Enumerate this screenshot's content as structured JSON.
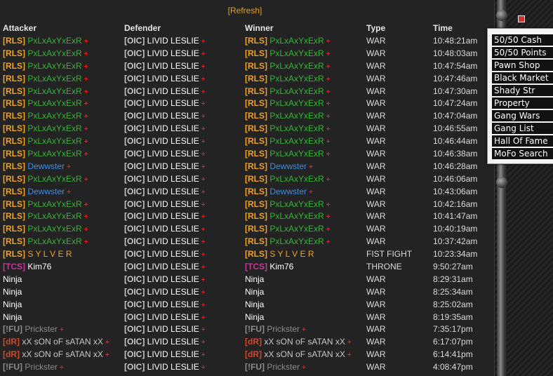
{
  "refresh": {
    "open": "[",
    "label": "Refresh",
    "close": "]"
  },
  "columns": [
    "Attacker",
    "Defender",
    "Winner",
    "Type",
    "Time"
  ],
  "colors": {
    "RLS": "#f0a020",
    "OIC": "#c8c8c8",
    "TCS": "#cc3399",
    "FU": "#8c8c8c",
    "dR": "#d04a2a",
    "plus": "#e02020"
  },
  "rows": [
    {
      "attacker": {
        "tag": "[RLS]",
        "tagColor": "#f0a020",
        "name": "PxLxAxYxExR",
        "nameColor": "#35b535",
        "plus": "+"
      },
      "defender": {
        "tag": "[OIC]",
        "tagColor": "#c8c8c8",
        "name": "LIVID LESLIE",
        "nameColor": "#ffffff",
        "plus": "+"
      },
      "winner": {
        "tag": "[RLS]",
        "tagColor": "#f0a020",
        "name": "PxLxAxYxExR",
        "nameColor": "#35b535",
        "plus": "+"
      },
      "type": "WAR",
      "time": "10:48:21am"
    },
    {
      "attacker": {
        "tag": "[RLS]",
        "tagColor": "#f0a020",
        "name": "PxLxAxYxExR",
        "nameColor": "#35b535",
        "plus": "+"
      },
      "defender": {
        "tag": "[OIC]",
        "tagColor": "#c8c8c8",
        "name": "LIVID LESLIE",
        "nameColor": "#ffffff",
        "plus": "+"
      },
      "winner": {
        "tag": "[RLS]",
        "tagColor": "#f0a020",
        "name": "PxLxAxYxExR",
        "nameColor": "#35b535",
        "plus": "+"
      },
      "type": "WAR",
      "time": "10:48:03am"
    },
    {
      "attacker": {
        "tag": "[RLS]",
        "tagColor": "#f0a020",
        "name": "PxLxAxYxExR",
        "nameColor": "#35b535",
        "plus": "+"
      },
      "defender": {
        "tag": "[OIC]",
        "tagColor": "#c8c8c8",
        "name": "LIVID LESLIE",
        "nameColor": "#ffffff",
        "plus": "+"
      },
      "winner": {
        "tag": "[RLS]",
        "tagColor": "#f0a020",
        "name": "PxLxAxYxExR",
        "nameColor": "#35b535",
        "plus": "+"
      },
      "type": "WAR",
      "time": "10:47:54am"
    },
    {
      "attacker": {
        "tag": "[RLS]",
        "tagColor": "#f0a020",
        "name": "PxLxAxYxExR",
        "nameColor": "#35b535",
        "plus": "+"
      },
      "defender": {
        "tag": "[OIC]",
        "tagColor": "#c8c8c8",
        "name": "LIVID LESLIE",
        "nameColor": "#ffffff",
        "plus": "+"
      },
      "winner": {
        "tag": "[RLS]",
        "tagColor": "#f0a020",
        "name": "PxLxAxYxExR",
        "nameColor": "#35b535",
        "plus": "+"
      },
      "type": "WAR",
      "time": "10:47:46am"
    },
    {
      "attacker": {
        "tag": "[RLS]",
        "tagColor": "#f0a020",
        "name": "PxLxAxYxExR",
        "nameColor": "#35b535",
        "plus": "+"
      },
      "defender": {
        "tag": "[OIC]",
        "tagColor": "#c8c8c8",
        "name": "LIVID LESLIE",
        "nameColor": "#ffffff",
        "plus": "+"
      },
      "winner": {
        "tag": "[RLS]",
        "tagColor": "#f0a020",
        "name": "PxLxAxYxExR",
        "nameColor": "#35b535",
        "plus": "+"
      },
      "type": "WAR",
      "time": "10:47:30am"
    },
    {
      "attacker": {
        "tag": "[RLS]",
        "tagColor": "#f0a020",
        "name": "PxLxAxYxExR",
        "nameColor": "#35b535",
        "plus": "+"
      },
      "defender": {
        "tag": "[OIC]",
        "tagColor": "#c8c8c8",
        "name": "LIVID LESLIE",
        "nameColor": "#ffffff",
        "plus": "+"
      },
      "winner": {
        "tag": "[RLS]",
        "tagColor": "#f0a020",
        "name": "PxLxAxYxExR",
        "nameColor": "#35b535",
        "plus": "+"
      },
      "type": "WAR",
      "time": "10:47:24am"
    },
    {
      "attacker": {
        "tag": "[RLS]",
        "tagColor": "#f0a020",
        "name": "PxLxAxYxExR",
        "nameColor": "#35b535",
        "plus": "+"
      },
      "defender": {
        "tag": "[OIC]",
        "tagColor": "#c8c8c8",
        "name": "LIVID LESLIE",
        "nameColor": "#ffffff",
        "plus": "+"
      },
      "winner": {
        "tag": "[RLS]",
        "tagColor": "#f0a020",
        "name": "PxLxAxYxExR",
        "nameColor": "#35b535",
        "plus": "+"
      },
      "type": "WAR",
      "time": "10:47:04am"
    },
    {
      "attacker": {
        "tag": "[RLS]",
        "tagColor": "#f0a020",
        "name": "PxLxAxYxExR",
        "nameColor": "#35b535",
        "plus": "+"
      },
      "defender": {
        "tag": "[OIC]",
        "tagColor": "#c8c8c8",
        "name": "LIVID LESLIE",
        "nameColor": "#ffffff",
        "plus": "+"
      },
      "winner": {
        "tag": "[RLS]",
        "tagColor": "#f0a020",
        "name": "PxLxAxYxExR",
        "nameColor": "#35b535",
        "plus": "+"
      },
      "type": "WAR",
      "time": "10:46:55am"
    },
    {
      "attacker": {
        "tag": "[RLS]",
        "tagColor": "#f0a020",
        "name": "PxLxAxYxExR",
        "nameColor": "#35b535",
        "plus": "+"
      },
      "defender": {
        "tag": "[OIC]",
        "tagColor": "#c8c8c8",
        "name": "LIVID LESLIE",
        "nameColor": "#ffffff",
        "plus": "+"
      },
      "winner": {
        "tag": "[RLS]",
        "tagColor": "#f0a020",
        "name": "PxLxAxYxExR",
        "nameColor": "#35b535",
        "plus": "+"
      },
      "type": "WAR",
      "time": "10:46:44am"
    },
    {
      "attacker": {
        "tag": "[RLS]",
        "tagColor": "#f0a020",
        "name": "PxLxAxYxExR",
        "nameColor": "#35b535",
        "plus": "+"
      },
      "defender": {
        "tag": "[OIC]",
        "tagColor": "#c8c8c8",
        "name": "LIVID LESLIE",
        "nameColor": "#ffffff",
        "plus": "+"
      },
      "winner": {
        "tag": "[RLS]",
        "tagColor": "#f0a020",
        "name": "PxLxAxYxExR",
        "nameColor": "#35b535",
        "plus": "+"
      },
      "type": "WAR",
      "time": "10:46:38am"
    },
    {
      "attacker": {
        "tag": "[RLS]",
        "tagColor": "#f0a020",
        "name": "Dewwster",
        "nameColor": "#3a8ee6",
        "plus": "+"
      },
      "defender": {
        "tag": "[OIC]",
        "tagColor": "#c8c8c8",
        "name": "LIVID LESLIE",
        "nameColor": "#ffffff",
        "plus": "+"
      },
      "winner": {
        "tag": "[RLS]",
        "tagColor": "#f0a020",
        "name": "Dewwster",
        "nameColor": "#3a8ee6",
        "plus": "+"
      },
      "type": "WAR",
      "time": "10:46:28am"
    },
    {
      "attacker": {
        "tag": "[RLS]",
        "tagColor": "#f0a020",
        "name": "PxLxAxYxExR",
        "nameColor": "#35b535",
        "plus": "+"
      },
      "defender": {
        "tag": "[OIC]",
        "tagColor": "#c8c8c8",
        "name": "LIVID LESLIE",
        "nameColor": "#ffffff",
        "plus": "+"
      },
      "winner": {
        "tag": "[RLS]",
        "tagColor": "#f0a020",
        "name": "PxLxAxYxExR",
        "nameColor": "#35b535",
        "plus": "+"
      },
      "type": "WAR",
      "time": "10:46:06am"
    },
    {
      "attacker": {
        "tag": "[RLS]",
        "tagColor": "#f0a020",
        "name": "Dewwster",
        "nameColor": "#3a8ee6",
        "plus": "+"
      },
      "defender": {
        "tag": "[OIC]",
        "tagColor": "#c8c8c8",
        "name": "LIVID LESLIE",
        "nameColor": "#ffffff",
        "plus": "+"
      },
      "winner": {
        "tag": "[RLS]",
        "tagColor": "#f0a020",
        "name": "Dewwster",
        "nameColor": "#3a8ee6",
        "plus": "+"
      },
      "type": "WAR",
      "time": "10:43:06am"
    },
    {
      "attacker": {
        "tag": "[RLS]",
        "tagColor": "#f0a020",
        "name": "PxLxAxYxExR",
        "nameColor": "#35b535",
        "plus": "+"
      },
      "defender": {
        "tag": "[OIC]",
        "tagColor": "#c8c8c8",
        "name": "LIVID LESLIE",
        "nameColor": "#ffffff",
        "plus": "+"
      },
      "winner": {
        "tag": "[RLS]",
        "tagColor": "#f0a020",
        "name": "PxLxAxYxExR",
        "nameColor": "#35b535",
        "plus": "+"
      },
      "type": "WAR",
      "time": "10:42:16am"
    },
    {
      "attacker": {
        "tag": "[RLS]",
        "tagColor": "#f0a020",
        "name": "PxLxAxYxExR",
        "nameColor": "#35b535",
        "plus": "+"
      },
      "defender": {
        "tag": "[OIC]",
        "tagColor": "#c8c8c8",
        "name": "LIVID LESLIE",
        "nameColor": "#ffffff",
        "plus": "+"
      },
      "winner": {
        "tag": "[RLS]",
        "tagColor": "#f0a020",
        "name": "PxLxAxYxExR",
        "nameColor": "#35b535",
        "plus": "+"
      },
      "type": "WAR",
      "time": "10:41:47am"
    },
    {
      "attacker": {
        "tag": "[RLS]",
        "tagColor": "#f0a020",
        "name": "PxLxAxYxExR",
        "nameColor": "#35b535",
        "plus": "+"
      },
      "defender": {
        "tag": "[OIC]",
        "tagColor": "#c8c8c8",
        "name": "LIVID LESLIE",
        "nameColor": "#ffffff",
        "plus": "+"
      },
      "winner": {
        "tag": "[RLS]",
        "tagColor": "#f0a020",
        "name": "PxLxAxYxExR",
        "nameColor": "#35b535",
        "plus": "+"
      },
      "type": "WAR",
      "time": "10:40:19am"
    },
    {
      "attacker": {
        "tag": "[RLS]",
        "tagColor": "#f0a020",
        "name": "PxLxAxYxExR",
        "nameColor": "#35b535",
        "plus": "+"
      },
      "defender": {
        "tag": "[OIC]",
        "tagColor": "#c8c8c8",
        "name": "LIVID LESLIE",
        "nameColor": "#ffffff",
        "plus": "+"
      },
      "winner": {
        "tag": "[RLS]",
        "tagColor": "#f0a020",
        "name": "PxLxAxYxExR",
        "nameColor": "#35b535",
        "plus": "+"
      },
      "type": "WAR",
      "time": "10:37:42am"
    },
    {
      "attacker": {
        "tag": "[RLS]",
        "tagColor": "#f0a020",
        "name": "S Y L V E R",
        "nameColor": "#f0a020",
        "plus": ""
      },
      "defender": {
        "tag": "[OIC]",
        "tagColor": "#c8c8c8",
        "name": "LIVID LESLIE",
        "nameColor": "#ffffff",
        "plus": "+"
      },
      "winner": {
        "tag": "[RLS]",
        "tagColor": "#f0a020",
        "name": "S Y L V E R",
        "nameColor": "#f0a020",
        "plus": ""
      },
      "type": "FIST FIGHT",
      "time": "10:23:34am"
    },
    {
      "attacker": {
        "tag": "[TCS]",
        "tagColor": "#cc3399",
        "name": "Kim76",
        "nameColor": "#ffffff",
        "plus": ""
      },
      "defender": {
        "tag": "[OIC]",
        "tagColor": "#c8c8c8",
        "name": "LIVID LESLIE",
        "nameColor": "#ffffff",
        "plus": "+"
      },
      "winner": {
        "tag": "[TCS]",
        "tagColor": "#cc3399",
        "name": "Kim76",
        "nameColor": "#ffffff",
        "plus": ""
      },
      "type": "THRONE",
      "time": "9:50:27am"
    },
    {
      "attacker": {
        "tag": "",
        "tagColor": "#ffffff",
        "name": "Ninja",
        "nameColor": "#ffffff",
        "plus": ""
      },
      "defender": {
        "tag": "[OIC]",
        "tagColor": "#c8c8c8",
        "name": "LIVID LESLIE",
        "nameColor": "#ffffff",
        "plus": "+"
      },
      "winner": {
        "tag": "",
        "tagColor": "#ffffff",
        "name": "Ninja",
        "nameColor": "#ffffff",
        "plus": ""
      },
      "type": "WAR",
      "time": "8:29:31am"
    },
    {
      "attacker": {
        "tag": "",
        "tagColor": "#ffffff",
        "name": "Ninja",
        "nameColor": "#ffffff",
        "plus": ""
      },
      "defender": {
        "tag": "[OIC]",
        "tagColor": "#c8c8c8",
        "name": "LIVID LESLIE",
        "nameColor": "#ffffff",
        "plus": "+"
      },
      "winner": {
        "tag": "",
        "tagColor": "#ffffff",
        "name": "Ninja",
        "nameColor": "#ffffff",
        "plus": ""
      },
      "type": "WAR",
      "time": "8:25:34am"
    },
    {
      "attacker": {
        "tag": "",
        "tagColor": "#ffffff",
        "name": "Ninja",
        "nameColor": "#ffffff",
        "plus": ""
      },
      "defender": {
        "tag": "[OIC]",
        "tagColor": "#c8c8c8",
        "name": "LIVID LESLIE",
        "nameColor": "#ffffff",
        "plus": "+"
      },
      "winner": {
        "tag": "",
        "tagColor": "#ffffff",
        "name": "Ninja",
        "nameColor": "#ffffff",
        "plus": ""
      },
      "type": "WAR",
      "time": "8:25:02am"
    },
    {
      "attacker": {
        "tag": "",
        "tagColor": "#ffffff",
        "name": "Ninja",
        "nameColor": "#ffffff",
        "plus": ""
      },
      "defender": {
        "tag": "[OIC]",
        "tagColor": "#c8c8c8",
        "name": "LIVID LESLIE",
        "nameColor": "#ffffff",
        "plus": "+"
      },
      "winner": {
        "tag": "",
        "tagColor": "#ffffff",
        "name": "Ninja",
        "nameColor": "#ffffff",
        "plus": ""
      },
      "type": "WAR",
      "time": "8:19:35am"
    },
    {
      "attacker": {
        "tag": "[!FU]",
        "tagColor": "#8c8c8c",
        "name": "Prickster",
        "nameColor": "#8c8c8c",
        "plus": "+"
      },
      "defender": {
        "tag": "[OIC]",
        "tagColor": "#c8c8c8",
        "name": "LIVID LESLIE",
        "nameColor": "#ffffff",
        "plus": "+"
      },
      "winner": {
        "tag": "[!FU]",
        "tagColor": "#8c8c8c",
        "name": "Prickster",
        "nameColor": "#8c8c8c",
        "plus": "+"
      },
      "type": "WAR",
      "time": "7:35:17pm"
    },
    {
      "attacker": {
        "tag": "[dR]",
        "tagColor": "#d04a2a",
        "name": "xX sON oF sATAN xX",
        "nameColor": "#c8c8c8",
        "plus": "+"
      },
      "defender": {
        "tag": "[OIC]",
        "tagColor": "#c8c8c8",
        "name": "LIVID LESLIE",
        "nameColor": "#ffffff",
        "plus": "+"
      },
      "winner": {
        "tag": "[dR]",
        "tagColor": "#d04a2a",
        "name": "xX sON oF sATAN xX",
        "nameColor": "#c8c8c8",
        "plus": "+"
      },
      "type": "WAR",
      "time": "6:17:07pm"
    },
    {
      "attacker": {
        "tag": "[dR]",
        "tagColor": "#d04a2a",
        "name": "xX sON oF sATAN xX",
        "nameColor": "#c8c8c8",
        "plus": "+"
      },
      "defender": {
        "tag": "[OIC]",
        "tagColor": "#c8c8c8",
        "name": "LIVID LESLIE",
        "nameColor": "#ffffff",
        "plus": "+"
      },
      "winner": {
        "tag": "[dR]",
        "tagColor": "#d04a2a",
        "name": "xX sON oF sATAN xX",
        "nameColor": "#c8c8c8",
        "plus": "+"
      },
      "type": "WAR",
      "time": "6:14:41pm"
    },
    {
      "attacker": {
        "tag": "[!FU]",
        "tagColor": "#8c8c8c",
        "name": "Prickster",
        "nameColor": "#8c8c8c",
        "plus": "+"
      },
      "defender": {
        "tag": "[OIC]",
        "tagColor": "#c8c8c8",
        "name": "LIVID LESLIE",
        "nameColor": "#ffffff",
        "plus": "+"
      },
      "winner": {
        "tag": "[!FU]",
        "tagColor": "#8c8c8c",
        "name": "Prickster",
        "nameColor": "#8c8c8c",
        "plus": "+"
      },
      "type": "WAR",
      "time": "4:08:47pm"
    }
  ],
  "menu": {
    "items": [
      "50/50 Cash",
      "50/50 Points",
      "Pawn Shop",
      "Black Market",
      "Shady Str",
      "Property",
      "Gang Wars",
      "Gang List",
      "Hall Of Fame",
      "MoFo Search"
    ]
  },
  "icons": {
    "plus": "plus-icon",
    "close": "close-icon"
  }
}
